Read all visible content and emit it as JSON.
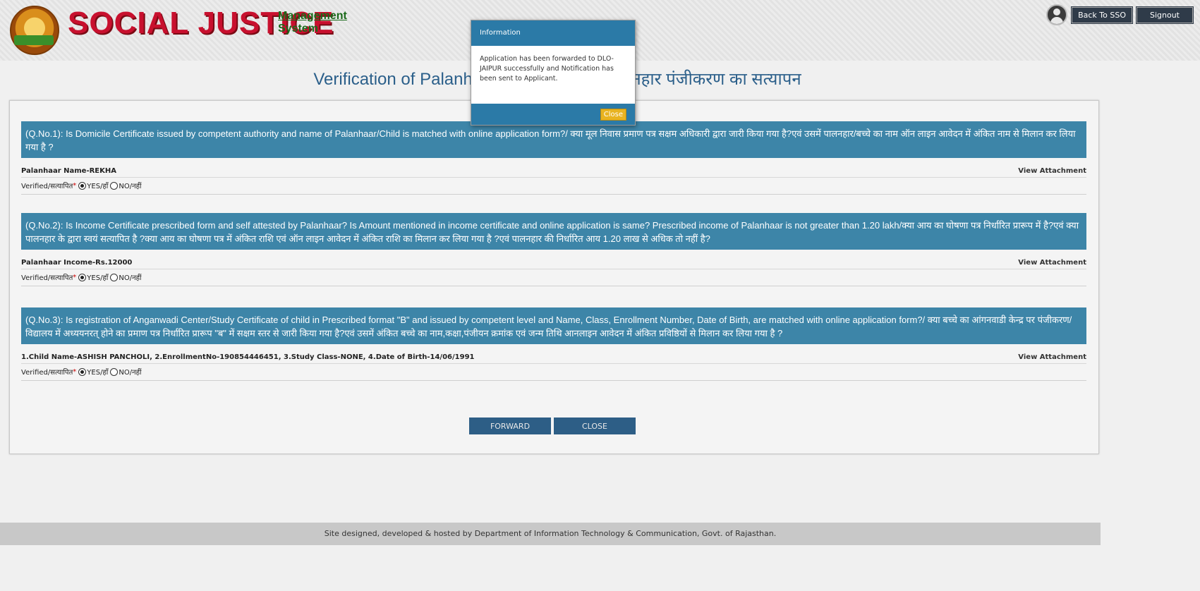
{
  "header": {
    "logo_title": "SOCIAL JUSTICE",
    "logo_sub_line1": "Management",
    "logo_sub_line2": "System",
    "back_to_sso": "Back To SSO",
    "signout": "Signout"
  },
  "page_title": "Verification of Palanhaar Registration / पालनहार पंजीकरण का सत्यापन",
  "questions": [
    {
      "text": "(Q.No.1): Is Domicile Certificate issued by competent authority and name of Palanhaar/Child is matched with online application form?/ क्या मूल निवास प्रमाण पत्र सक्षम अधिकारी द्वारा जारी किया गया है?एवं उसमें पालनहार/बच्चे का नाम ऑन लाइन आवेदन में अंकित नाम से मिलान कर लिया गया है ?",
      "detail": "Palanhaar Name-REKHA",
      "attachment": "View Attachment",
      "verified_label": "Verified/सत्यापित",
      "yes": "YES/हाँ",
      "no": "NO/नहीं",
      "selected": "yes"
    },
    {
      "text": "(Q.No.2): Is Income Certificate prescribed form and self attested by Palanhaar? Is Amount mentioned in income certificate and online application is same? Prescribed income of Palanhaar is not greater than 1.20 lakh/क्या आय का घोषणा पत्र निर्धारित प्रारूप में है?एवं क्या पालनहार के द्वारा स्वयं सत्यापित है ?क्या आय का घोषणा पत्र में अंकित राशि एवं ऑन लाइन आवेदन में अंकित राशि का मिलान कर लिया गया है ?एवं पालनहार की निर्धारित आय 1.20 लाख से अधिक तो नहीं है?",
      "detail": "Palanhaar Income-Rs.12000",
      "attachment": "View Attachment",
      "verified_label": "Verified/सत्यापित",
      "yes": "YES/हाँ",
      "no": "NO/नहीं",
      "selected": "yes"
    },
    {
      "text": "(Q.No.3): Is registration of Anganwadi Center/Study Certificate of child in Prescribed format \"B\" and issued by competent level and Name, Class, Enrollment Number, Date of Birth, are matched with online application form?/ क्या बच्चे का आंगनवाडी केन्द्र पर पंजीकरण/विद्यालय में अध्ययनरत् होने का प्रमाण पत्र निर्धारित प्रारूप \"ब\" में सक्षम स्तर से जारी किया गया है?एवं उसमें अंकित बच्चे का नाम,कक्षा,पंजीयन क्रमांक एवं जन्म तिथि आनलाइन आवेदन में अंकित प्रविष्ठियों से मिलान कर लिया गया है ?",
      "detail": "1.Child Name-ASHISH PANCHOLI, 2.EnrollmentNo-190854446451, 3.Study Class-NONE, 4.Date of Birth-14/06/1991",
      "attachment": "View Attachment",
      "verified_label": "Verified/सत्यापित",
      "yes": "YES/हाँ",
      "no": "NO/नहीं",
      "selected": "yes"
    }
  ],
  "buttons": {
    "forward": "FORWARD",
    "close": "CLOSE"
  },
  "footer": "Site designed, developed & hosted by Department of Information Technology & Communication, Govt. of Rajasthan.",
  "modal": {
    "title": "Information",
    "message": "Application has been forwarded to DLO-JAIPUR successfully and Notification has been sent to Applicant.",
    "close": "Close"
  }
}
